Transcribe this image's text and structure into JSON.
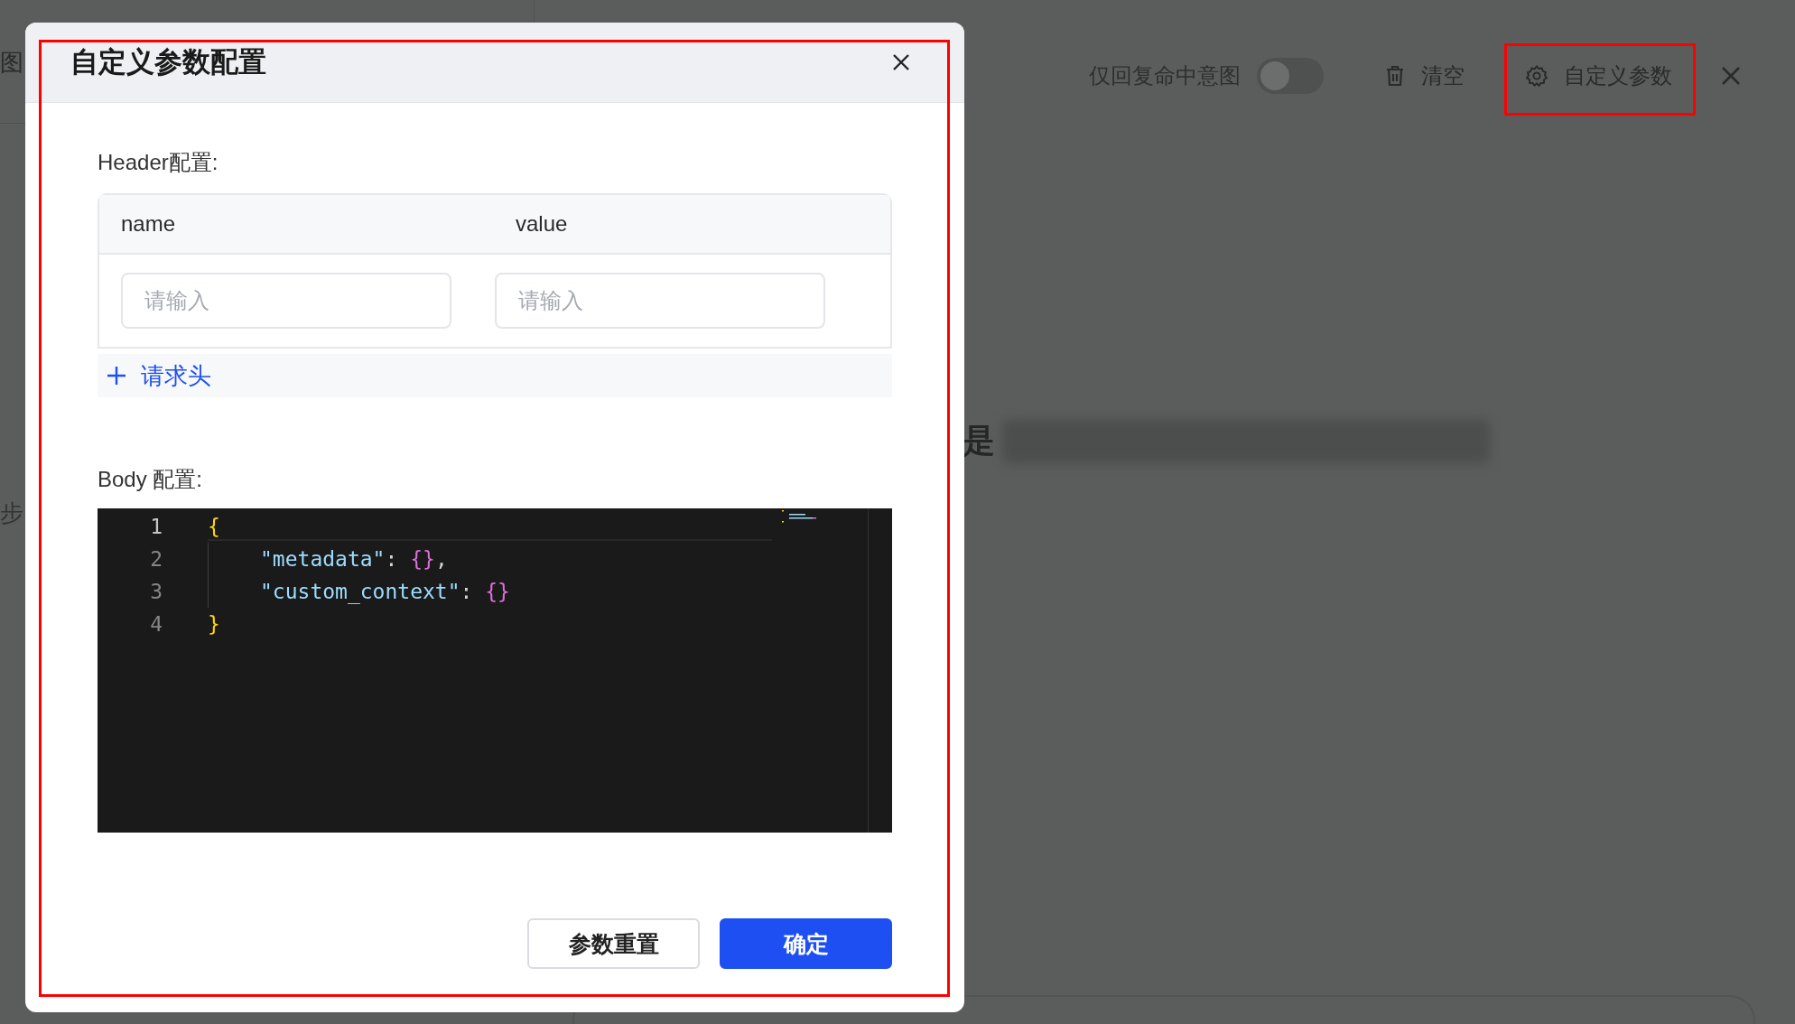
{
  "background": {
    "partial_texts": [
      {
        "kind": "side-top",
        "text": "图"
      },
      {
        "kind": "side-bottom",
        "text": "步"
      },
      {
        "kind": "main",
        "text": "是"
      }
    ],
    "toolbar": {
      "toggle": {
        "label": "仅回复命中意图",
        "on": false
      },
      "clear_button": "清空",
      "custom_params_button": "自定义参数"
    }
  },
  "dialog": {
    "title": "自定义参数配置",
    "header_section": {
      "label": "Header配置:",
      "columns": [
        "name",
        "value"
      ],
      "rows": [
        {
          "name_placeholder": "请输入",
          "value_placeholder": "请输入"
        }
      ],
      "add_button": "请求头"
    },
    "body_section": {
      "label": "Body 配置:",
      "code_lines": [
        {
          "number": "1",
          "indented": false,
          "tokens": [
            {
              "kind": "brace-outer",
              "text": "{"
            }
          ]
        },
        {
          "number": "2",
          "indented": true,
          "tokens": [
            {
              "kind": "key",
              "text": "\"metadata\""
            },
            {
              "kind": "punct",
              "text": ": "
            },
            {
              "kind": "brace-inner",
              "text": "{}"
            },
            {
              "kind": "punct",
              "text": ","
            }
          ]
        },
        {
          "number": "3",
          "indented": true,
          "tokens": [
            {
              "kind": "key",
              "text": "\"custom_context\""
            },
            {
              "kind": "punct",
              "text": ": "
            },
            {
              "kind": "brace-inner",
              "text": "{}"
            }
          ]
        },
        {
          "number": "4",
          "indented": false,
          "tokens": [
            {
              "kind": "brace-outer",
              "text": "}"
            }
          ]
        }
      ]
    },
    "buttons": [
      {
        "kind": "secondary",
        "label": "参数重置"
      },
      {
        "kind": "primary",
        "label": "确定"
      }
    ]
  },
  "highlight_frames": {
    "dialog": true,
    "custom_params_button": true
  }
}
